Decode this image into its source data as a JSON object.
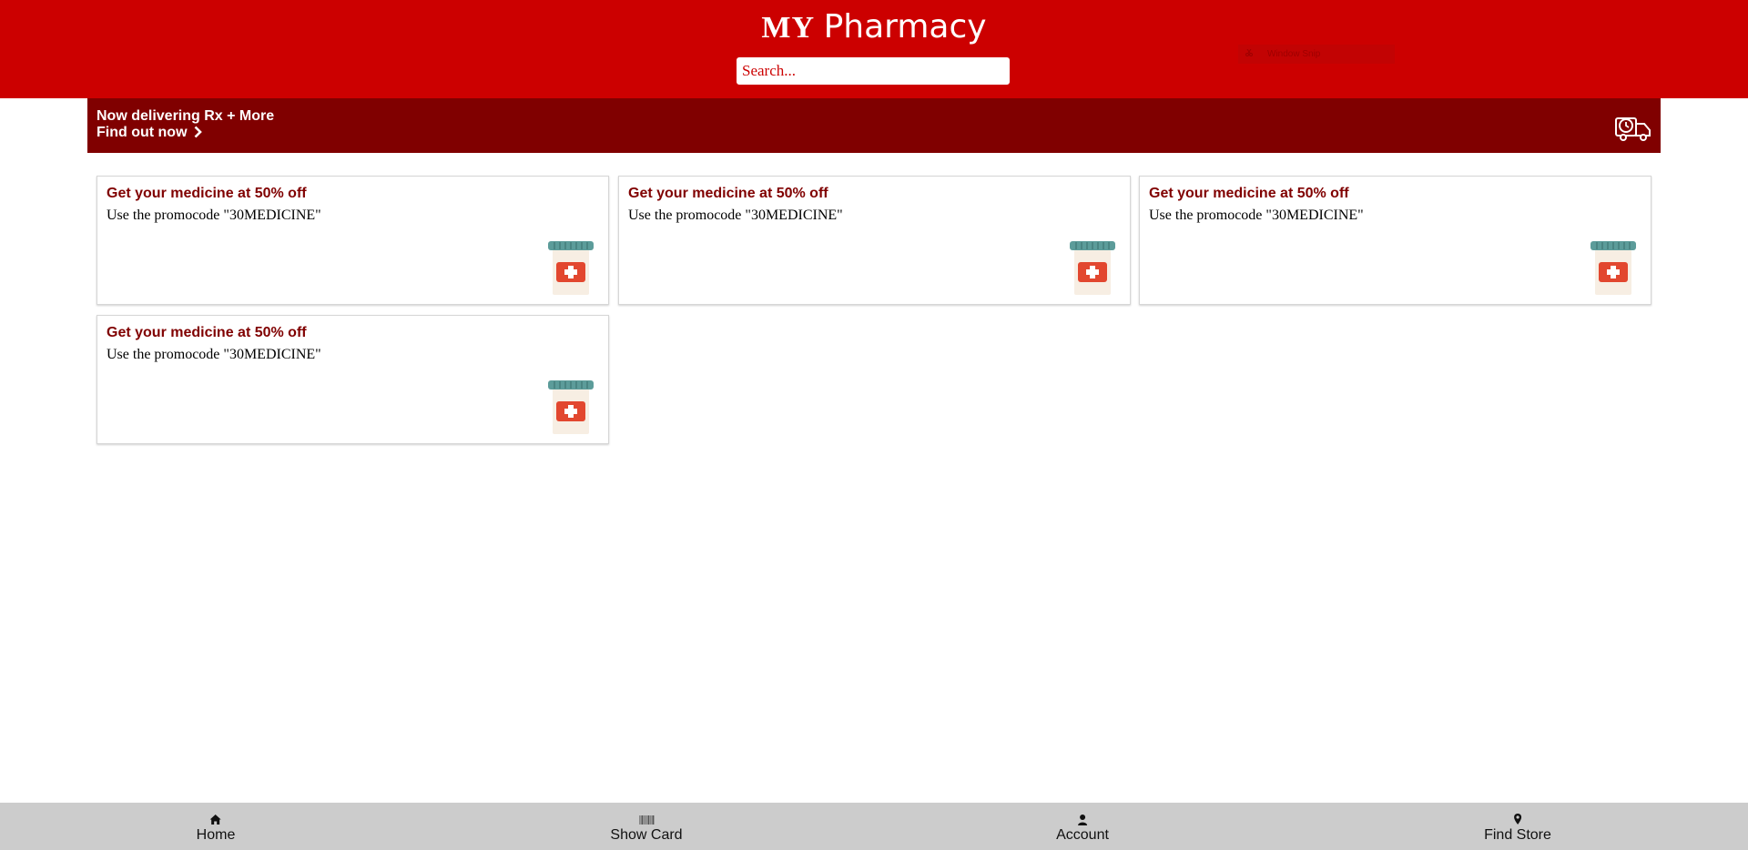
{
  "header": {
    "brand_prefix": "MY",
    "brand_name": "Pharmacy",
    "search_placeholder": "Search...",
    "snip_label": "Window Snip",
    "bg_color": "#cc0000"
  },
  "banner": {
    "line1": "Now delivering Rx + More",
    "line2": "Find out now",
    "icon": "delivery-truck-icon",
    "bg_color": "#800000"
  },
  "promos": [
    {
      "title": "Get your medicine at 50% off",
      "description": "Use the promocode \"30MEDICINE\"",
      "icon": "medicine-bottle-icon"
    },
    {
      "title": "Get your medicine at 50% off",
      "description": "Use the promocode \"30MEDICINE\"",
      "icon": "medicine-bottle-icon"
    },
    {
      "title": "Get your medicine at 50% off",
      "description": "Use the promocode \"30MEDICINE\"",
      "icon": "medicine-bottle-icon"
    },
    {
      "title": "Get your medicine at 50% off",
      "description": "Use the promocode \"30MEDICINE\"",
      "icon": "medicine-bottle-icon"
    }
  ],
  "footer_nav": [
    {
      "label": "Home",
      "icon": "home-icon"
    },
    {
      "label": "Show Card",
      "icon": "barcode-icon"
    },
    {
      "label": "Account",
      "icon": "user-icon"
    },
    {
      "label": "Find Store",
      "icon": "map-marker-icon"
    }
  ]
}
